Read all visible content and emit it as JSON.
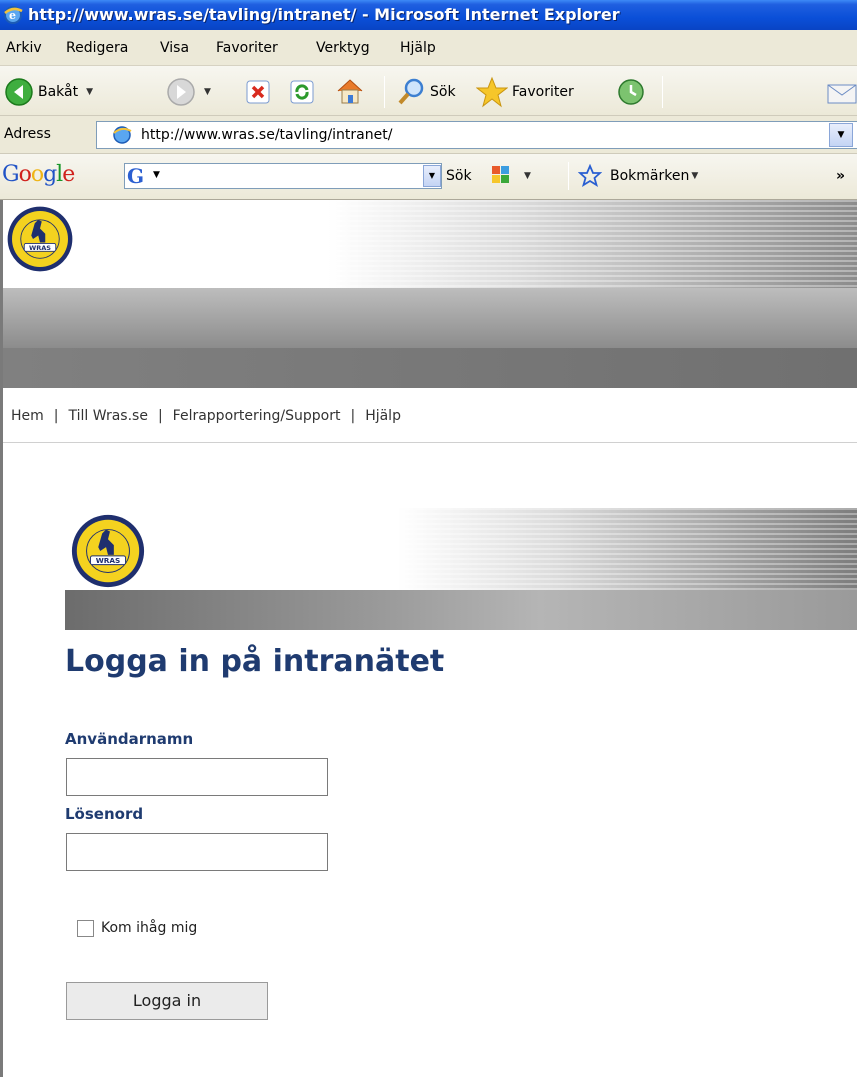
{
  "window": {
    "title": "http://www.wras.se/tavling/intranet/ - Microsoft Internet Explorer"
  },
  "menu": [
    "Arkiv",
    "Redigera",
    "Visa",
    "Favoriter",
    "Verktyg",
    "Hjälp"
  ],
  "toolbar": {
    "back_label": "Bakåt",
    "search_label": "Sök",
    "favorites_label": "Favoriter"
  },
  "address": {
    "label": "Adress",
    "url": "http://www.wras.se/tavling/intranet/"
  },
  "google_bar": {
    "logo": [
      "G",
      "o",
      "o",
      "g",
      "l",
      "e"
    ],
    "search_label": "Sök",
    "bookmarks_label": "Bokmärken",
    "overflow": "»"
  },
  "nav": {
    "items": [
      "Hem",
      "Till Wras.se",
      "Felrapportering/Support",
      "Hjälp"
    ]
  },
  "logo_text": "WRAS",
  "login": {
    "title": "Logga in på intranätet",
    "username_label": "Användarnamn",
    "username_value": "",
    "password_label": "Lösenord",
    "password_value": "",
    "remember_label": "Kom ihåg mig",
    "remember_checked": false,
    "submit_label": "Logga in"
  },
  "colors": {
    "heading": "#1f3b70",
    "titlebar": "#0a4fd8",
    "chrome": "#ece9d8"
  }
}
